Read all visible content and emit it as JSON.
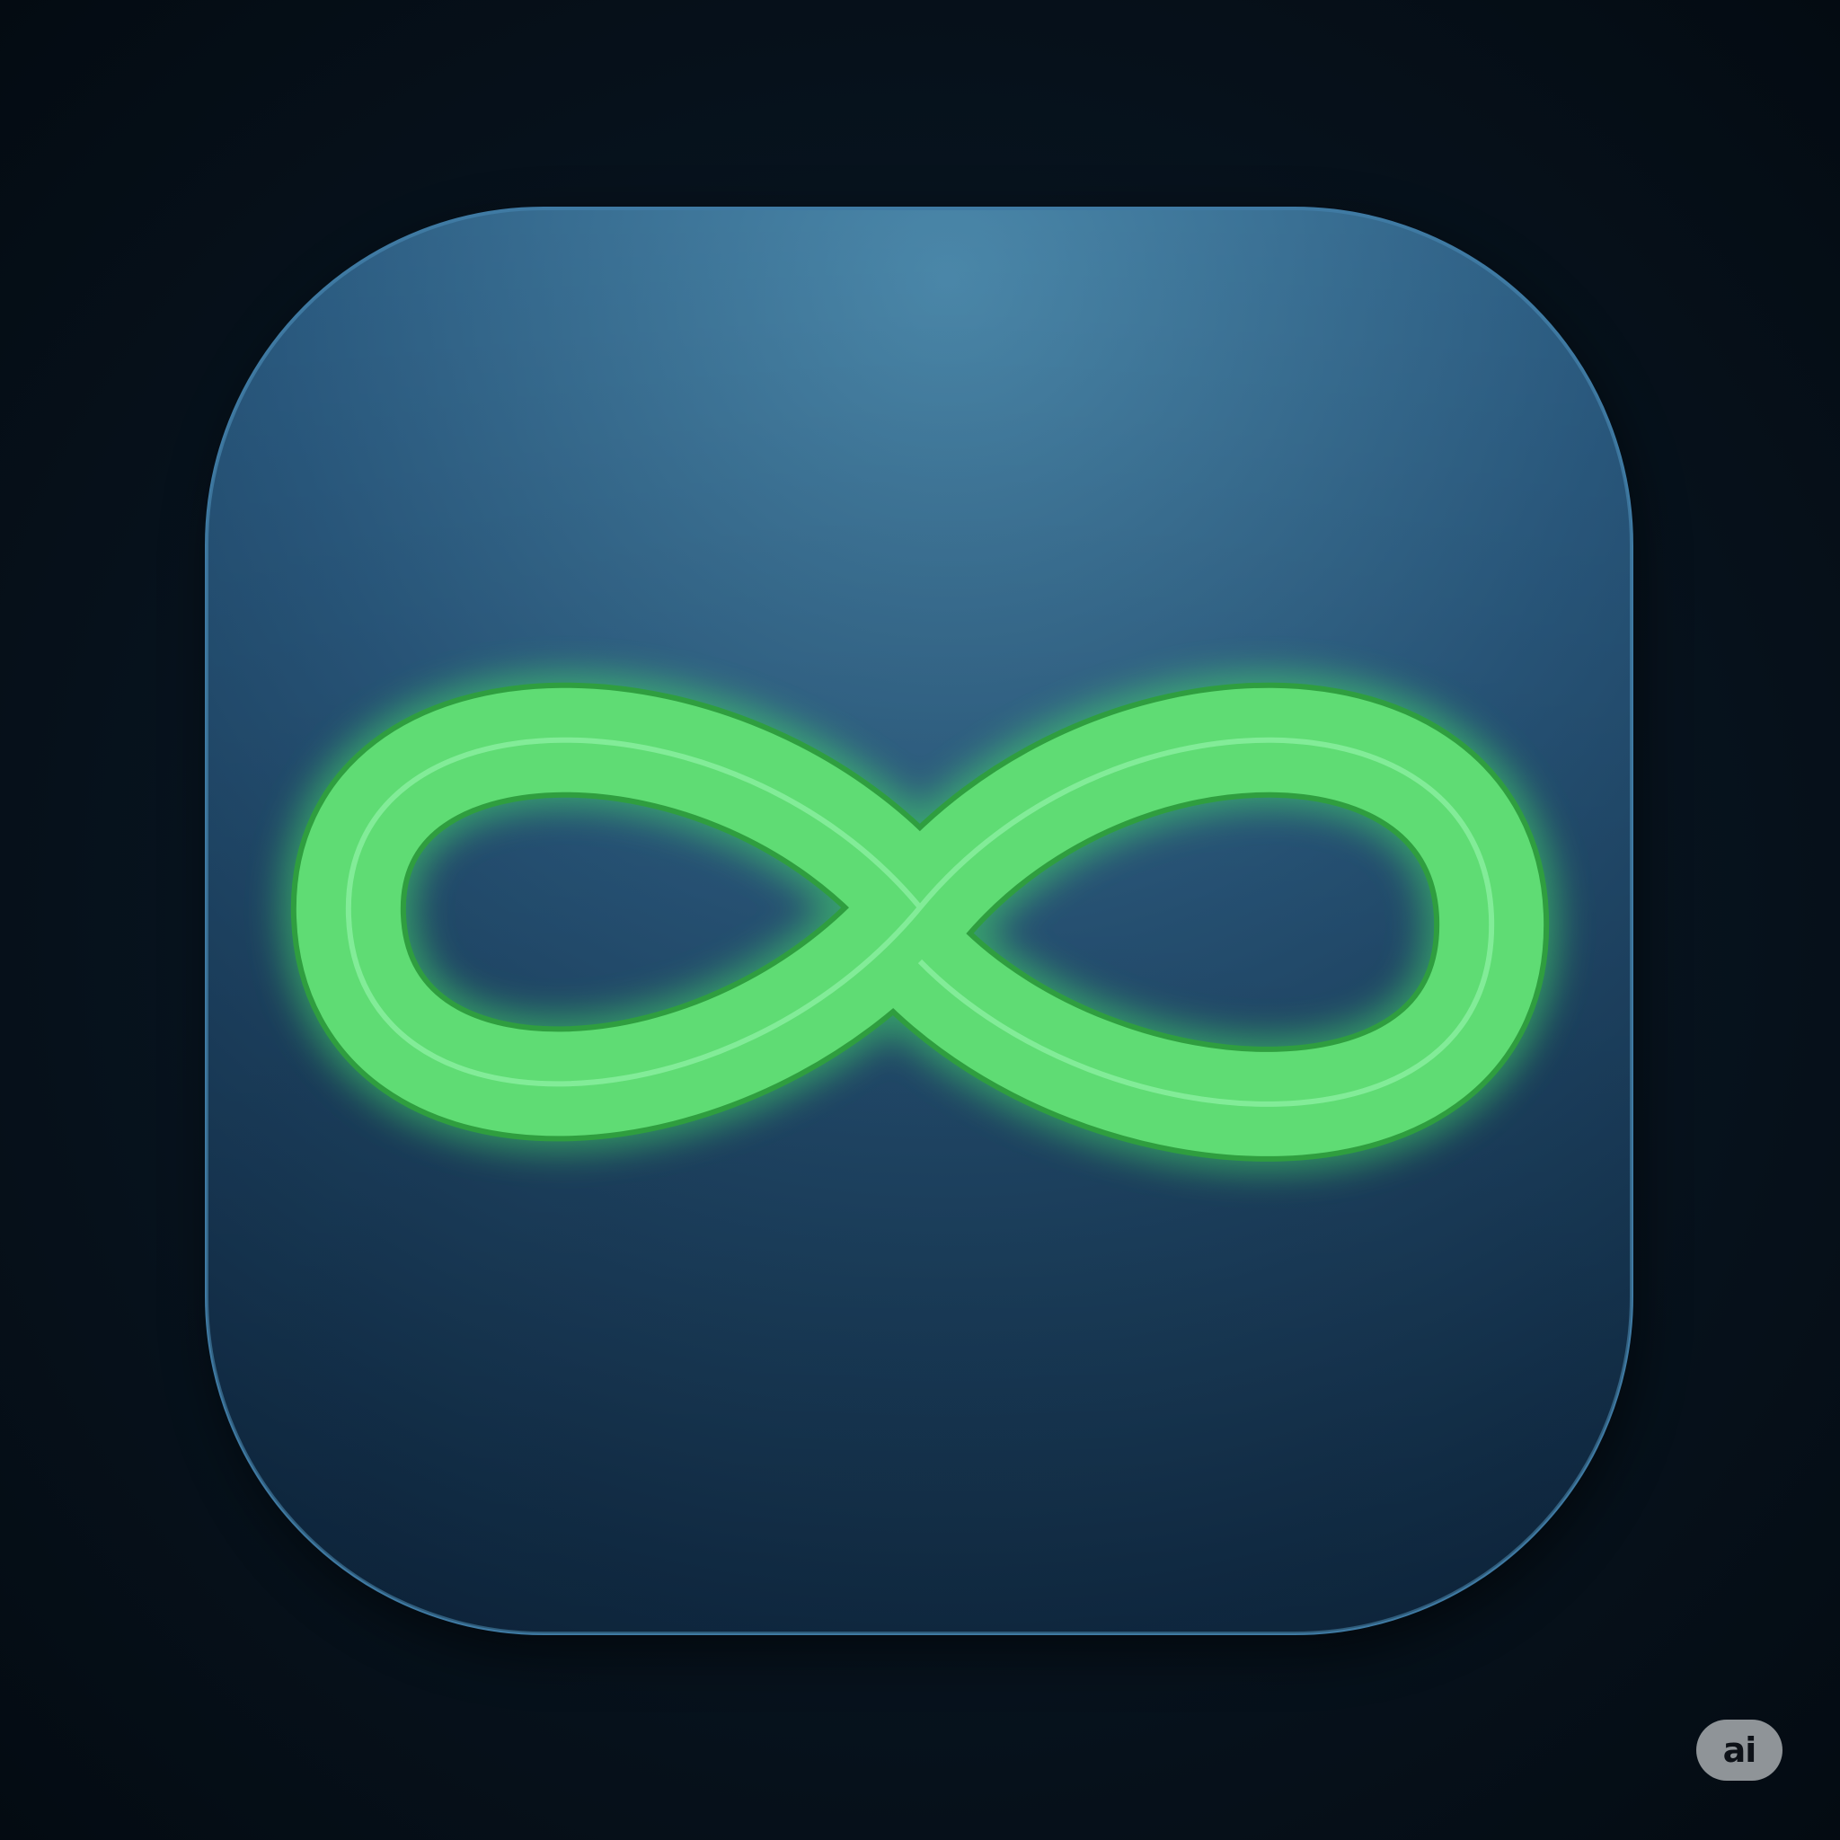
{
  "scene": {
    "icon_name": "infinity-icon",
    "background_color": "#06101a",
    "tile_color_top": "#4a86a8",
    "tile_color_bottom": "#10304e",
    "symbol_color": "#5fe07a",
    "symbol_glow_color": "#4dff6a"
  },
  "badge": {
    "label": "ai"
  }
}
